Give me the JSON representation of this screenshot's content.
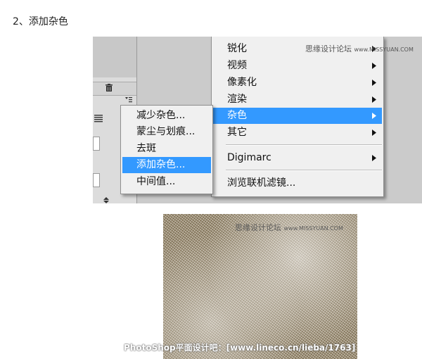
{
  "step_title": "2、添加杂色",
  "photoshop_filter_menu": {
    "items": [
      {
        "label": "锐化",
        "has_submenu": true
      },
      {
        "label": "视频",
        "has_submenu": true
      },
      {
        "label": "像素化",
        "has_submenu": true
      },
      {
        "label": "渲染",
        "has_submenu": true
      },
      {
        "label": "杂色",
        "has_submenu": true,
        "highlighted": true
      },
      {
        "label": "其它",
        "has_submenu": true
      },
      {
        "label": "Digimarc",
        "has_submenu": true
      },
      {
        "label": "浏览联机滤镜...",
        "has_submenu": false
      }
    ]
  },
  "noise_submenu": {
    "items": [
      {
        "label": "减少杂色..."
      },
      {
        "label": "蒙尘与划痕..."
      },
      {
        "label": "去斑"
      },
      {
        "label": "添加杂色...",
        "highlighted": true
      },
      {
        "label": "中间值..."
      }
    ]
  },
  "watermarks": {
    "menu_watermark_cn": "思缘设计论坛",
    "menu_watermark_url": "www.MISSYUAN.COM",
    "noise_watermark_cn": "思缘设计论坛",
    "noise_watermark_url": "www.MISSYUAN.COM",
    "footer": "PhotoShop平面设计吧：[www.lineco.cn/lieba/1763]"
  },
  "colors": {
    "highlight": "#3399ff",
    "menu_bg": "#f0f0f0"
  },
  "icons": [
    "trash-icon",
    "panel-menu-icon",
    "list-icon",
    "stepper-icon",
    "submenu-arrow-icon"
  ]
}
